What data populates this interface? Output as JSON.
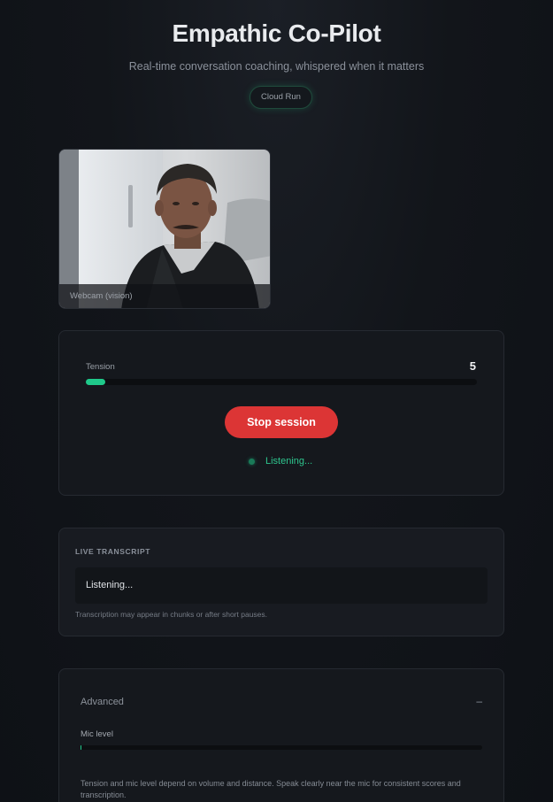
{
  "header": {
    "title": "Empathic Co-Pilot",
    "subtitle": "Real-time conversation coaching, whispered when it matters",
    "badge": "Cloud Run"
  },
  "webcam": {
    "caption": "Webcam (vision)"
  },
  "session": {
    "tension_label": "Tension",
    "tension_value": "5",
    "tension_fraction": 0.05,
    "stop_button_label": "Stop session",
    "status_text": "Listening...",
    "status_color": "#2ec58e"
  },
  "transcript": {
    "section_title": "LIVE TRANSCRIPT",
    "text": "Listening...",
    "note": "Transcription may appear in chunks or after short pauses."
  },
  "advanced": {
    "title": "Advanced",
    "toggle_label": "–",
    "mic_label": "Mic level",
    "mic_fraction": 0.002,
    "note": "Tension and mic level depend on volume and distance. Speak clearly near the mic for consistent scores and transcription."
  },
  "colors": {
    "accent": "#1fc98a",
    "danger": "#dc3535",
    "background": "#101318"
  }
}
